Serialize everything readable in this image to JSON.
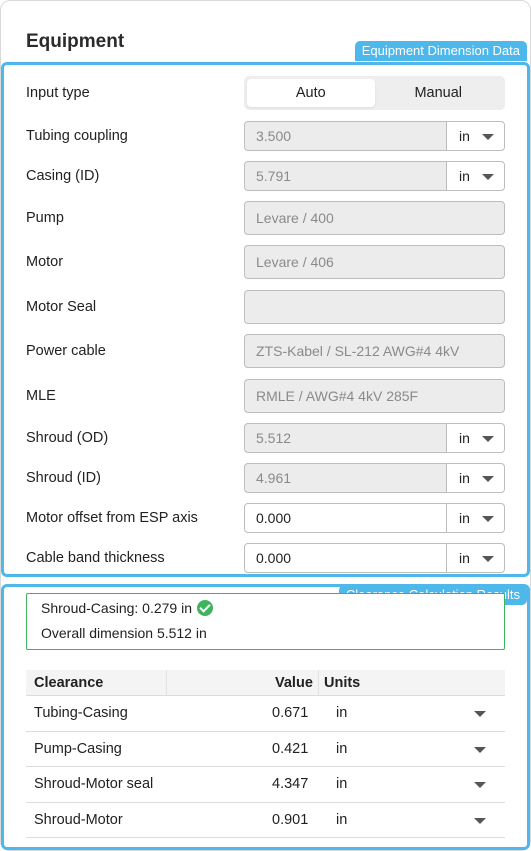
{
  "panel": {
    "title": "Equipment"
  },
  "equipment_section": {
    "tag": "Equipment Dimension Data",
    "input_type": {
      "label": "Input type",
      "options": [
        "Auto",
        "Manual"
      ],
      "selected": "Auto"
    },
    "tubing_coupling": {
      "label": "Tubing coupling",
      "value": "3.500",
      "unit": "in"
    },
    "casing_id": {
      "label": "Casing (ID)",
      "value": "5.791",
      "unit": "in"
    },
    "pump": {
      "label": "Pump",
      "value": "Levare / 400"
    },
    "motor": {
      "label": "Motor",
      "value": "Levare / 406"
    },
    "motor_seal": {
      "label": "Motor Seal",
      "value": ""
    },
    "power_cable": {
      "label": "Power cable",
      "value": "ZTS-Kabel / SL-212 AWG#4 4kV"
    },
    "mle": {
      "label": "MLE",
      "value": "RMLE / AWG#4 4kV 285F"
    },
    "shroud_od": {
      "label": "Shroud (OD)",
      "value": "5.512",
      "unit": "in"
    },
    "shroud_id": {
      "label": "Shroud (ID)",
      "value": "4.961",
      "unit": "in"
    },
    "motor_offset": {
      "label": "Motor offset from ESP axis",
      "value": "0.000",
      "unit": "in"
    },
    "cable_band": {
      "label": "Cable band thickness",
      "value": "0.000",
      "unit": "in"
    }
  },
  "clearance_section": {
    "tag": "Clearance Calculation Results",
    "summary": {
      "line1": "Shroud-Casing: 0.279 in",
      "line2": "Overall dimension 5.512 in"
    },
    "table": {
      "headers": {
        "clearance": "Clearance",
        "value": "Value",
        "units": "Units"
      },
      "rows": [
        {
          "name": "Tubing-Casing",
          "value": "0.671",
          "unit": "in"
        },
        {
          "name": "Pump-Casing",
          "value": "0.421",
          "unit": "in"
        },
        {
          "name": "Shroud-Motor seal",
          "value": "4.347",
          "unit": "in"
        },
        {
          "name": "Shroud-Motor",
          "value": "0.901",
          "unit": "in"
        }
      ]
    }
  },
  "colors": {
    "accent": "#4fb8ea",
    "success": "#3fb45f"
  }
}
